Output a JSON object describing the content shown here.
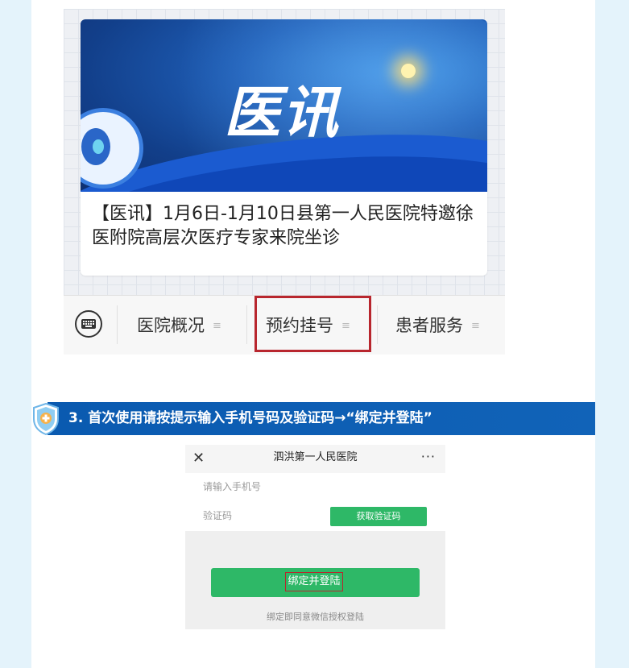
{
  "screenshot1": {
    "banner_logo": "医讯",
    "news_title": "【医讯】1月6日-1月10日县第一人民医院特邀徐医附院高层次医疗专家来院坐诊",
    "tabs": [
      {
        "label": "医院概况",
        "menu_glyph": "≡"
      },
      {
        "label": "预约挂号",
        "menu_glyph": "≡"
      },
      {
        "label": "患者服务",
        "menu_glyph": "≡"
      }
    ],
    "highlight_color": "#b8262e"
  },
  "step3": {
    "text": "3. 首次使用请按提示输入手机号码及验证码→“绑定并登陆”",
    "bar_color": "#0a5ab0"
  },
  "screenshot2": {
    "nav": {
      "close": "✕",
      "title": "泗洪第一人民医院",
      "more": "···"
    },
    "phone_placeholder": "请输入手机号",
    "code_label": "验证码",
    "get_code_button": "获取验证码",
    "bind_button": "绑定并登陆",
    "agree_text": "绑定即同意微信授权登陆",
    "accent_color": "#2eb867"
  }
}
